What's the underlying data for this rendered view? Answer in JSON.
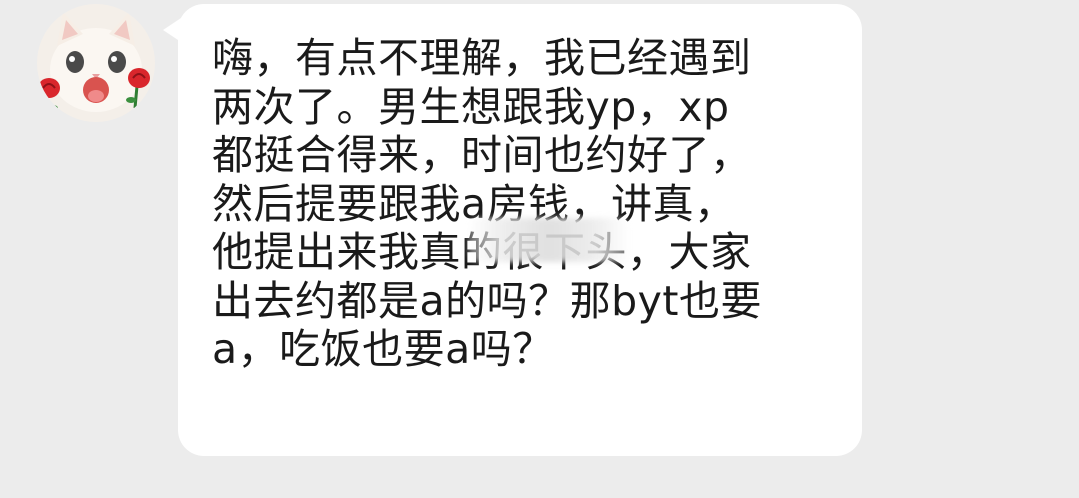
{
  "chat": {
    "message": {
      "lines": [
        "嗨，有点不理解，我已经遇到",
        "两次了。男生想跟我yp，xp",
        "都挺合得来，时间也约好了，",
        "然后提要跟我a房钱，讲真，",
        "他提出来我真的很下头，大家",
        "出去约都是a的吗？那byt也要",
        "a，吃饭也要a吗？"
      ]
    },
    "avatar": {
      "icon": "kitten-with-roses-icon"
    }
  },
  "colors": {
    "background": "#ececec",
    "bubble": "#ffffff",
    "text": "#1a1a1a",
    "rose": "#d9262c"
  }
}
